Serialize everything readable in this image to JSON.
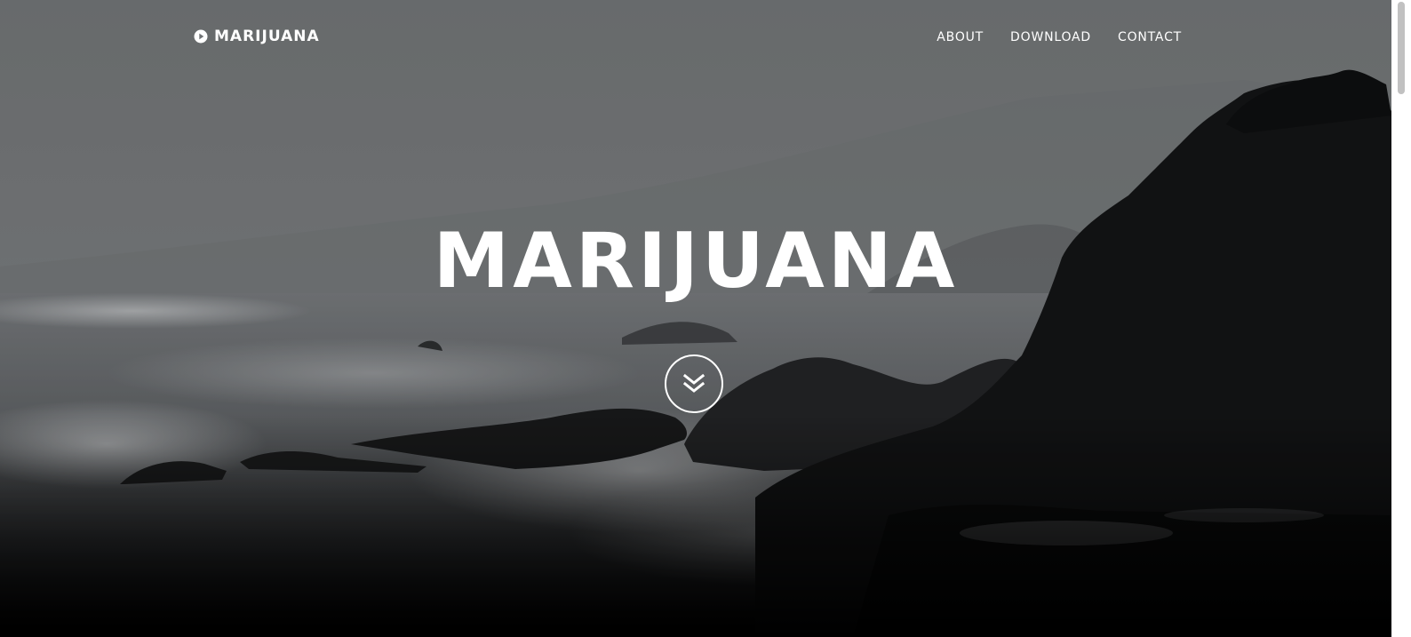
{
  "brand": {
    "name": "MARIJUANA",
    "icon": "play-circle-icon"
  },
  "nav": {
    "items": [
      {
        "label": "ABOUT"
      },
      {
        "label": "DOWNLOAD"
      },
      {
        "label": "CONTACT"
      }
    ]
  },
  "hero": {
    "title": "MARIJUANA",
    "background": "misty-coastal-cliffs-photo",
    "scroll_icon": "double-chevron-down-icon"
  },
  "colors": {
    "text": "#ffffff",
    "sky": "#7b7e80",
    "sea": "#6a6d70",
    "cliff": "#141516",
    "bottom": "#000000"
  }
}
